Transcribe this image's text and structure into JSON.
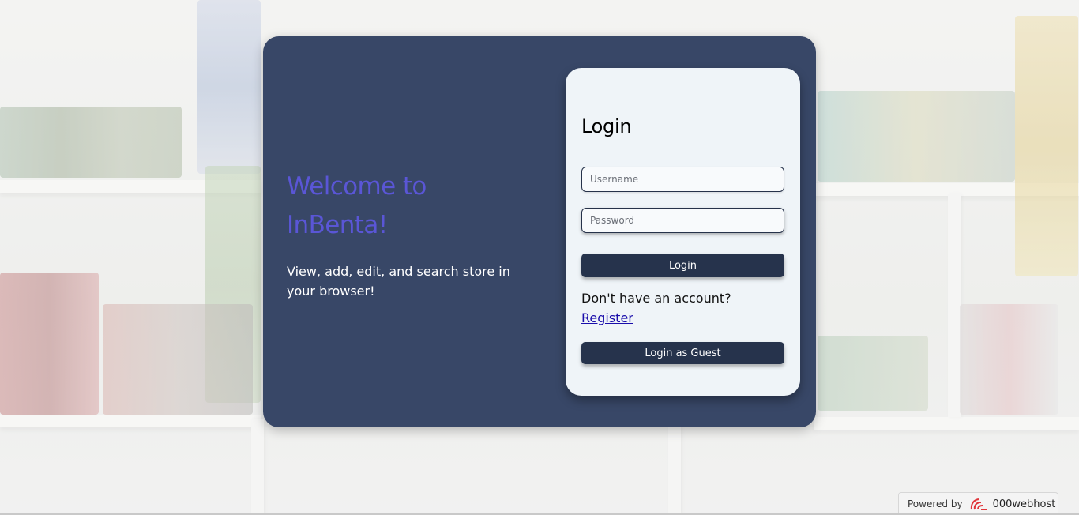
{
  "hero": {
    "title": "Welcome to InBenta!",
    "subtitle": "View, add, edit, and search store in your browser!"
  },
  "login": {
    "title": "Login",
    "username_placeholder": "Username",
    "password_placeholder": "Password",
    "login_button": "Login",
    "no_account_text": "Don't have an account?",
    "register_link": "Register",
    "guest_button": "Login as Guest"
  },
  "footer": {
    "powered_by": "Powered by",
    "host_name": "000webhost",
    "host_icon": "000webhost-logo-icon"
  },
  "colors": {
    "card_bg": "#384767",
    "accent": "#5a56d6",
    "panel_bg": "#eff4f8",
    "button_bg": "#26334c",
    "link": "#1a0dab"
  }
}
